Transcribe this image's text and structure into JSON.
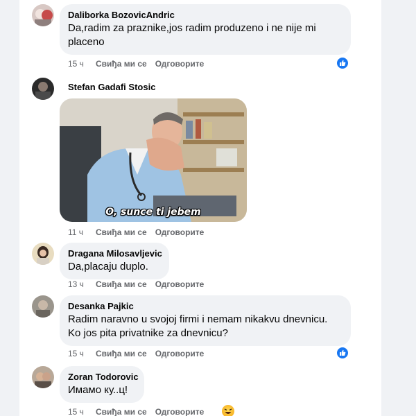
{
  "comments": [
    {
      "author": "Daliborka BozovicAndric",
      "text": "Da,radim za praznike,jos radim produzeno i ne nije mi placeno",
      "time": "15 ч",
      "like": "Свиђа ми се",
      "reply": "Одговорите",
      "reaction": "like-reaction-icon"
    },
    {
      "author": "Stefan Gadafi Stosic",
      "gif_caption": "O, sunce ti jebem",
      "time": "11 ч",
      "like": "Свиђа ми се",
      "reply": "Одговорите"
    },
    {
      "author": "Dragana Milosavljevic",
      "text": "Da,placaju duplo.",
      "time": "13 ч",
      "like": "Свиђа ми се",
      "reply": "Одговорите"
    },
    {
      "author": "Desanka Pajkic",
      "text": "Radim naravno u svojoj firmi i nemam nikakvu dnevnicu. Ko jos pita privatnike za dnevnicu?",
      "time": "15 ч",
      "like": "Свиђа ми се",
      "reply": "Одговорите",
      "reaction": "like-reaction-icon"
    },
    {
      "author": "Zoran Todorovic",
      "text": "Имамо ку..ц!",
      "time": "15 ч",
      "like": "Свиђа ми се",
      "reply": "Одговорите",
      "reaction": "haha-reaction-icon"
    }
  ],
  "colors": {
    "page_bg": "#f0f2f5",
    "card_bg": "#ffffff",
    "bubble_bg": "#f0f2f5",
    "meta_text": "#65676b",
    "like_blue": "#1877f2"
  }
}
